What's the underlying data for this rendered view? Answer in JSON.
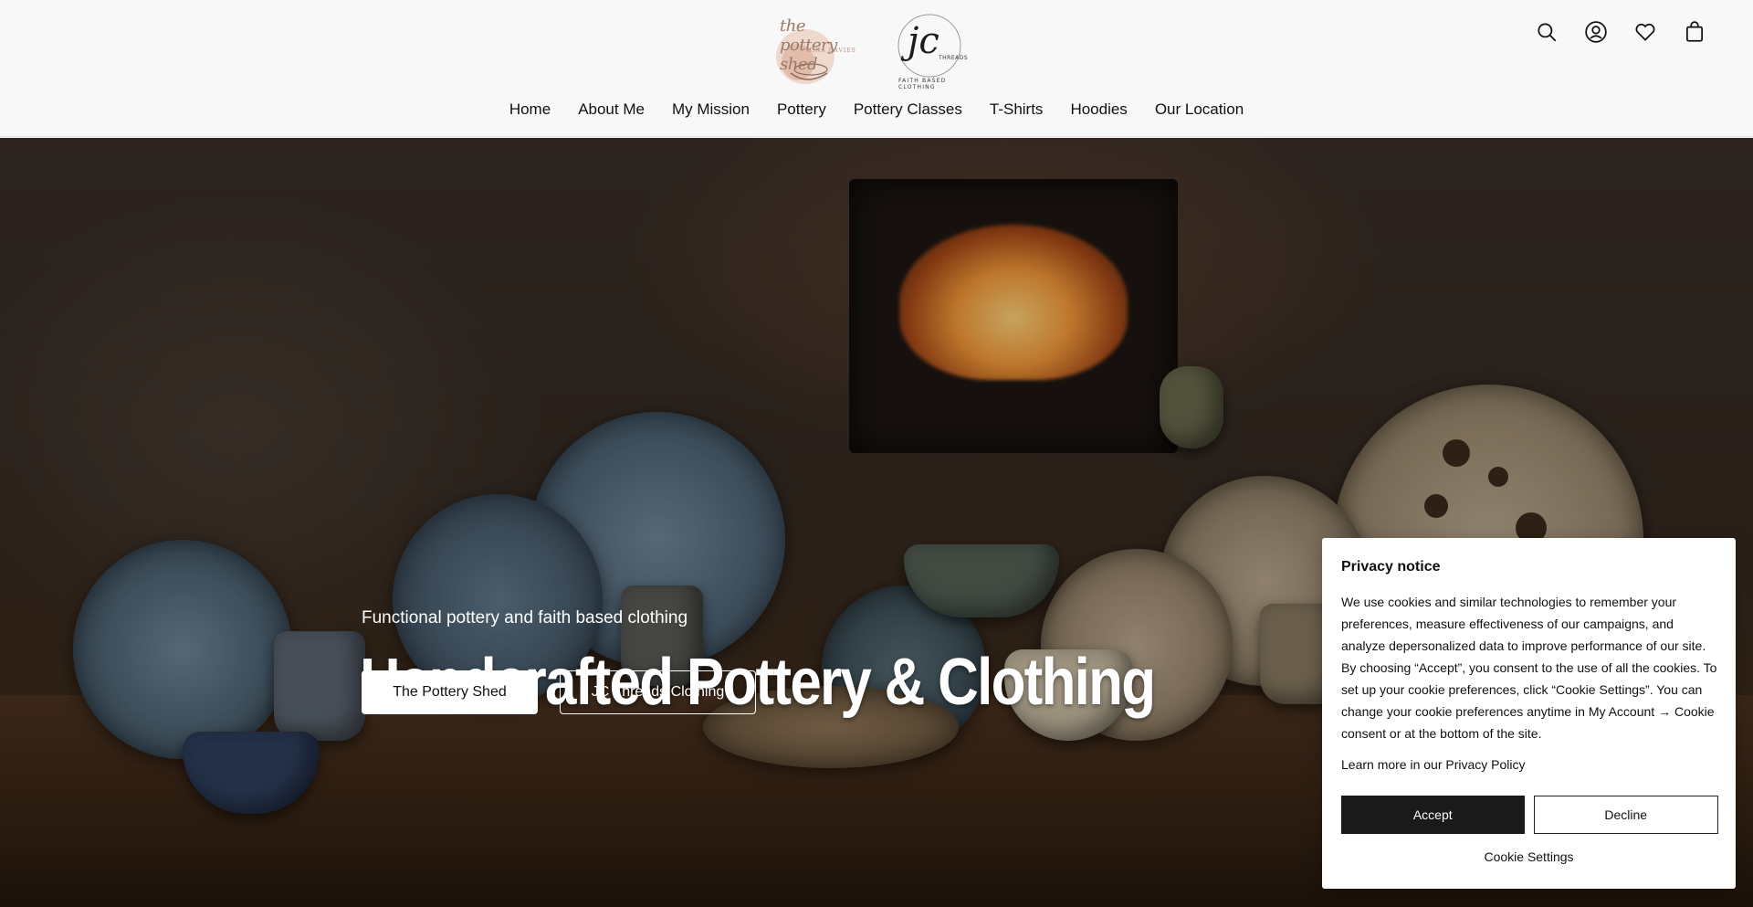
{
  "header": {
    "logos": [
      {
        "name": "The Pottery Shed",
        "script_text": "the pottery shed",
        "sub_text": "GINA DAVIES"
      },
      {
        "name": "JC Threads",
        "monogram": "jc",
        "word": "THREADS",
        "tagline": "FAITH BASED CLOTHING"
      }
    ],
    "icons": [
      "search-icon",
      "account-icon",
      "wishlist-icon",
      "cart-icon"
    ],
    "nav": [
      {
        "label": "Home"
      },
      {
        "label": "About Me"
      },
      {
        "label": "My Mission"
      },
      {
        "label": "Pottery"
      },
      {
        "label": "Pottery Classes"
      },
      {
        "label": "T-Shirts"
      },
      {
        "label": "Hoodies"
      },
      {
        "label": "Our Location"
      }
    ]
  },
  "hero": {
    "title": "Handcrafted Pottery & Clothing",
    "subtitle": "Functional pottery and faith based clothing",
    "buttons": [
      {
        "label": "The Pottery Shed"
      },
      {
        "label": "JC Threads Clothing"
      }
    ]
  },
  "privacy": {
    "title": "Privacy notice",
    "body": "We use cookies and similar technologies to remember your preferences, measure effectiveness of our campaigns, and analyze depersonalized data to improve performance of our site. By choosing “Accept”, you consent to the use of all the cookies. To set up your cookie preferences, click “Cookie Settings”. You can change your cookie preferences anytime in My Account → Cookie consent or at the bottom of the site.",
    "learn_more": "Learn more in our Privacy Policy",
    "accept_label": "Accept",
    "decline_label": "Decline",
    "settings_label": "Cookie Settings"
  },
  "colors": {
    "header_bg": "#f8f8f8",
    "accept_bg": "#1a1a1a",
    "text": "#111111"
  }
}
